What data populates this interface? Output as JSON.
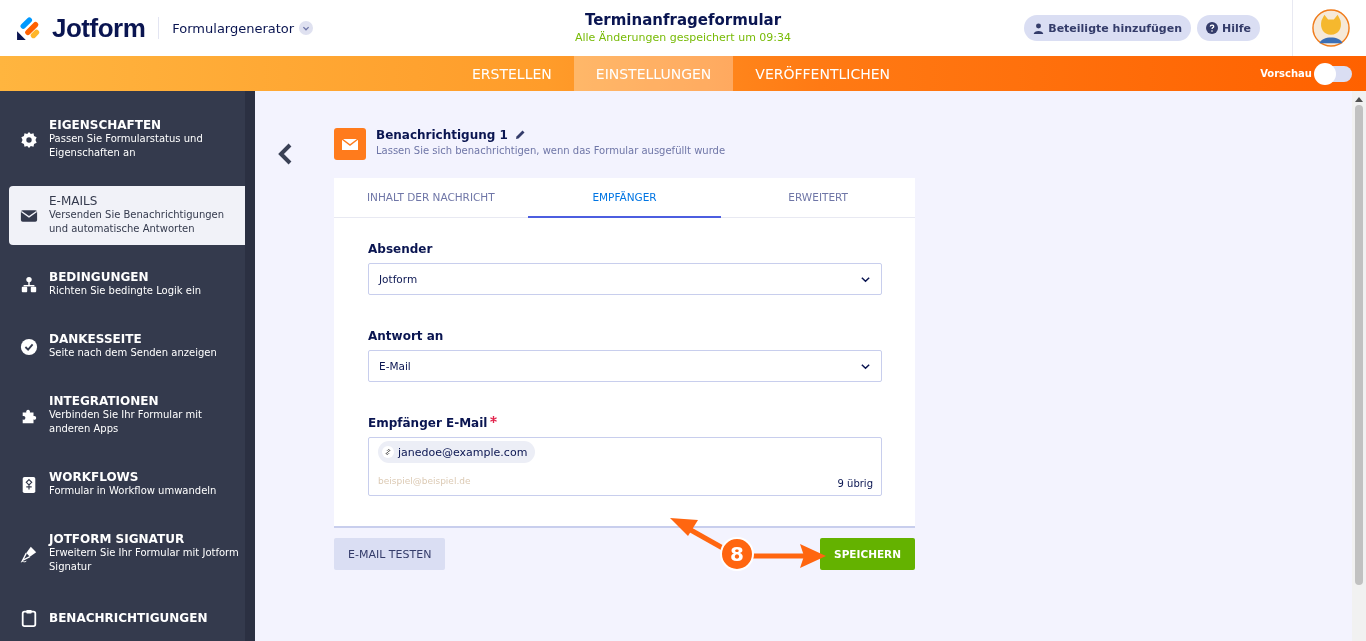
{
  "header": {
    "brand": "Jotform",
    "product": "Formulargenerator",
    "title": "Terminanfrageformular",
    "saved_status": "Alle Änderungen gespeichert um 09:34",
    "buttons": [
      {
        "kind": "people",
        "label": "Beteiligte hinzufügen"
      },
      {
        "kind": "help",
        "label": "Hilfe"
      }
    ]
  },
  "nav": {
    "tabs": [
      {
        "label": "ERSTELLEN",
        "selected": false
      },
      {
        "label": "EINSTELLUNGEN",
        "selected": true
      },
      {
        "label": "VERÖFFENTLICHEN",
        "selected": false
      }
    ],
    "preview": {
      "label": "Vorschau",
      "on": false
    }
  },
  "sidebar": {
    "items": [
      {
        "title": "EIGENSCHAFTEN",
        "description": "Passen Sie Formularstatus und Eigenschaften an",
        "selected": false
      },
      {
        "title": "E-MAILS",
        "description": "Versenden Sie Benachrichtigungen und automatische Antworten",
        "selected": true
      },
      {
        "title": "BEDINGUNGEN",
        "description": "Richten Sie bedingte Logik ein",
        "selected": false
      },
      {
        "title": "DANKESSEITE",
        "description": "Seite nach dem Senden anzeigen",
        "selected": false
      },
      {
        "title": "INTEGRATIONEN",
        "description": "Verbinden Sie Ihr Formular mit anderen Apps",
        "selected": false
      },
      {
        "title": "WORKFLOWS",
        "description": "Formular in Workflow umwandeln",
        "selected": false
      },
      {
        "title": "JOTFORM SIGNATUR",
        "description": "Erweitern Sie Ihr Formular mit Jotform Signatur",
        "selected": false
      },
      {
        "title": "BENACHRICHTIGUNGEN",
        "selected": false
      }
    ]
  },
  "notification": {
    "title": "Benachrichtigung 1",
    "subtitle": "Lassen Sie sich benachrichtigen, wenn das Formular ausgefüllt wurde"
  },
  "tabs": [
    {
      "label": "INHALT DER NACHRICHT",
      "selected": false
    },
    {
      "label": "EMPFÄNGER",
      "selected": true
    },
    {
      "label": "ERWEITERT",
      "selected": false
    }
  ],
  "fields": [
    {
      "kind": "select",
      "label": "Absender",
      "required": false,
      "value": "Jotform"
    },
    {
      "kind": "select",
      "label": "Antwort an",
      "required": false,
      "value": "E-Mail"
    },
    {
      "kind": "tags",
      "label": "Empfänger E-Mail",
      "required": true,
      "tags": [
        "janedoe@example.com"
      ],
      "placeholder": "beispiel@beispiel.de",
      "counter": "9 übrig"
    }
  ],
  "buttons": {
    "test": "E-MAIL TESTEN",
    "save": "SPEICHERN"
  },
  "annotation": {
    "label": "8"
  }
}
